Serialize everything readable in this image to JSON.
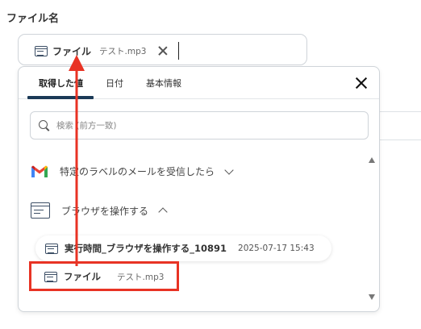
{
  "field": {
    "label": "ファイル名",
    "chip": {
      "label": "ファイル",
      "sub": "テスト.mp3"
    }
  },
  "popup": {
    "tabs": [
      "取得した値",
      "日付",
      "基本情報"
    ],
    "search_placeholder": "検索 (前方一致)",
    "groups": [
      {
        "label": "特定のラベルのメールを受信したら",
        "icon": "gmail-icon",
        "expanded": false
      },
      {
        "label": "ブラウザを操作する",
        "icon": "browser-icon",
        "expanded": true
      }
    ],
    "items": [
      {
        "label": "実行時間_ブラウザを操作する_10891",
        "sub": "2025-07-17 15:43"
      },
      {
        "label": "ファイル",
        "sub": "テスト.mp3"
      }
    ]
  },
  "colors": {
    "accent": "#1b3a57",
    "annotation": "#e83324"
  }
}
